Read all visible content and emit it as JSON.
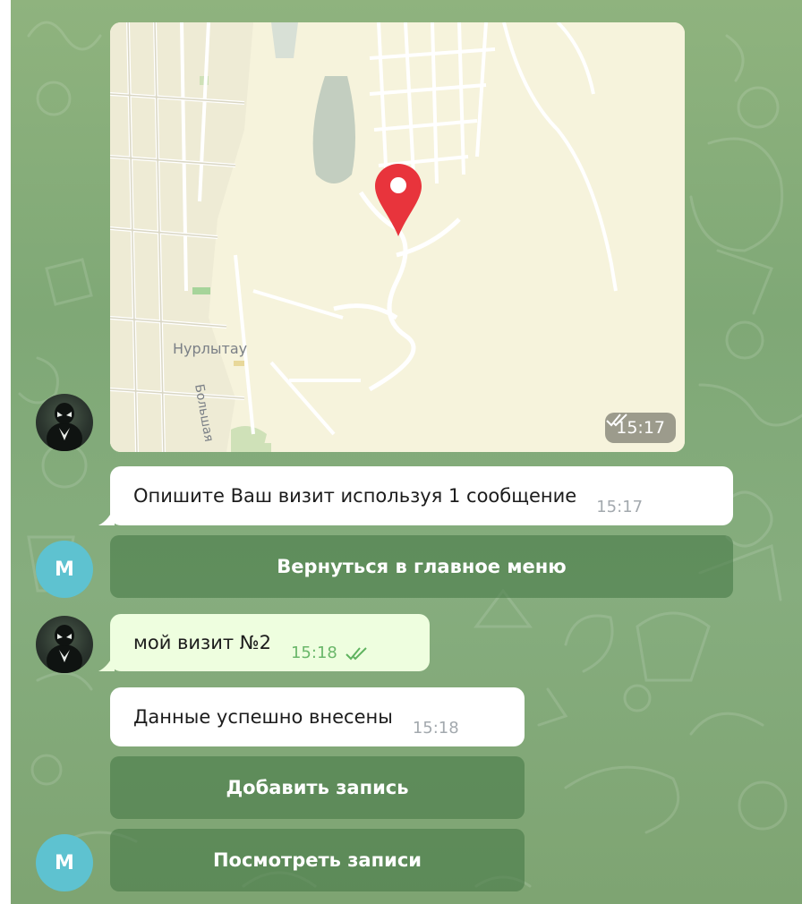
{
  "map": {
    "place_label": "Нурлытау",
    "street_label": "Большая",
    "time": "15:17",
    "status_icon": "double-check-icon"
  },
  "messages": {
    "prompt": {
      "text": "Опишите Ваш визит используя 1 сообщение",
      "time": "15:17"
    },
    "user_visit": {
      "text": "мой визит №2",
      "time": "15:18",
      "status_icon": "double-check-icon"
    },
    "confirmation": {
      "text": "Данные успешно внесены",
      "time": "15:18"
    }
  },
  "buttons": {
    "back_to_menu": "Вернуться в главное меню",
    "add_record": "Добавить запись",
    "view_records": "Посмотреть записи"
  },
  "avatars": {
    "bot_letter": "M",
    "user_avatar_icon": "venom-avatar-icon"
  },
  "colors": {
    "chat_background": "#86ad7e",
    "incoming_bubble": "#ffffff",
    "outgoing_bubble": "#eefedf",
    "keyboard_button": "#5f915d",
    "bot_avatar": "#5ec2d0",
    "map_pin": "#e8343c"
  }
}
